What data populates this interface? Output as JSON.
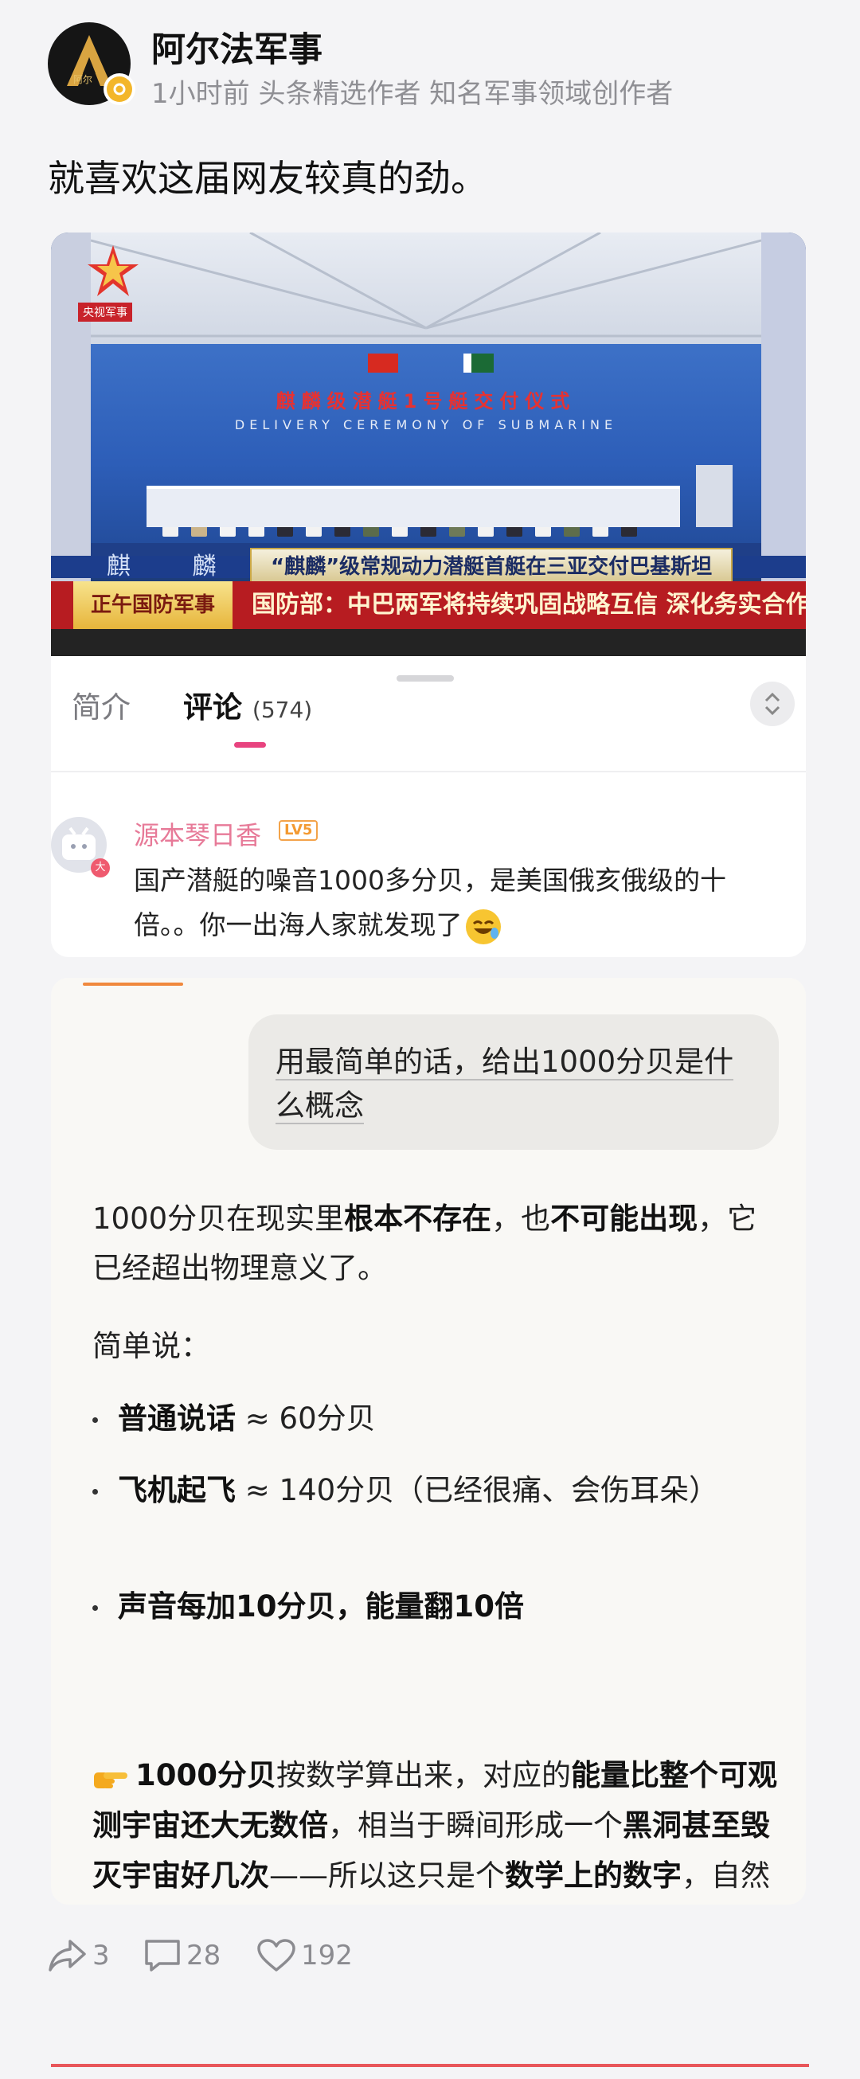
{
  "author": {
    "name": "阿尔法军事",
    "meta": "1小时前 头条精选作者 知名军事领域创作者",
    "avatar_icon": "alpha-logo-icon",
    "verified_icon": "verified-badge-icon"
  },
  "post": {
    "text": "就喜欢这届网友较真的劲。"
  },
  "video": {
    "channel_label": "央视军事",
    "backdrop_title": "麒麟级潜艇1号艇交付仪式",
    "backdrop_subtitle": "DELIVERY CEREMONY OF SUBMARINE",
    "ticker_top_text": "麒 麟",
    "ticker_mid_text": "“麒麟”级常规动力潜艇首艇在三亚交付巴基斯坦",
    "show_name": "正午国防军事",
    "headline": "国防部：中巴两军将持续巩固战略互信 深化务实合作"
  },
  "tabs": {
    "intro": "简介",
    "comments": "评论",
    "comments_count": "(574)"
  },
  "comment": {
    "username": "源本琴日香",
    "level": "LV5",
    "avatar_badge": "大",
    "text": "国产潜艇的噪音1000多分贝，是美国俄亥俄级的十倍。。你一出海人家就发现了"
  },
  "chat": {
    "user_prompt": "用最简单的话，给出1000分贝是什么概念",
    "answer": {
      "p1_a": "1000分贝在现实里",
      "p1_b": "根本不存在",
      "p1_c": "，也",
      "p1_d": "不可能出现",
      "p1_e": "，它已经超出物理意义了。",
      "p2": "简单说：",
      "b1_bold": "普通说话",
      "b1_rest": " ≈ 60分贝",
      "b2_bold": "飞机起飞",
      "b2_rest": " ≈ 140分贝（已经很痛、会伤耳朵）",
      "b3_bold": "声音每加10分贝，能量翻10倍",
      "last_a": "1000分贝",
      "last_b": "按数学算出来，对应的",
      "last_c": "能量比整个可观测宇宙还大无数倍",
      "last_d": "，相当于瞬间形成一个",
      "last_e": "黑洞甚至毁灭宇宙好几次",
      "last_f": "——所以这只是个",
      "last_g": "数学上的数字",
      "last_h": "，自然界不允许存在。"
    }
  },
  "actions": {
    "share_count": "3",
    "comment_count": "28",
    "like_count": "192"
  },
  "colors": {
    "accent_pink": "#e8437f",
    "username_pink": "#e77a98",
    "level_orange": "#f39a32",
    "bottom_red": "#e8565a"
  }
}
